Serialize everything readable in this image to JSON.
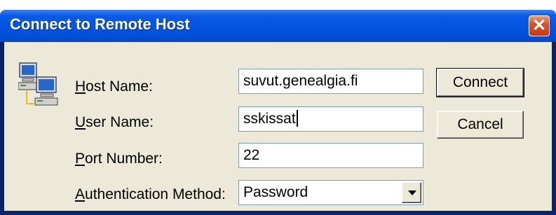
{
  "window": {
    "title": "Connect to Remote Host"
  },
  "titlebar": {
    "close_glyph": "✕"
  },
  "form": {
    "host_label_acc": "H",
    "host_label_rest": "ost Name:",
    "host_value": "suvut.genealgia.fi",
    "user_label_acc": "U",
    "user_label_rest": "ser Name:",
    "user_value": "sskissat",
    "port_label_acc": "P",
    "port_label_rest": "ort Number:",
    "port_value": "22",
    "auth_label_acc": "A",
    "auth_label_rest": "uthentication Method:",
    "auth_selected": "Password"
  },
  "buttons": {
    "connect": "Connect",
    "cancel": "Cancel"
  },
  "icons": {
    "host": "networked-computers-icon",
    "close": "close-icon",
    "dropdown": "chevron-down-icon"
  }
}
